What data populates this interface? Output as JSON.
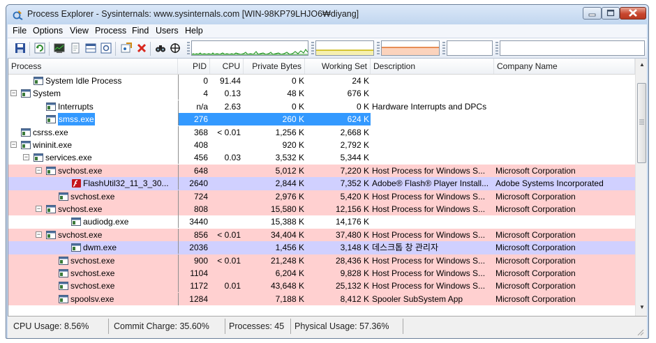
{
  "window": {
    "title": "Process Explorer - Sysinternals: www.sysinternals.com [WIN-98KP79LHJO6₩diyang]"
  },
  "menu": [
    "File",
    "Options",
    "View",
    "Process",
    "Find",
    "Users",
    "Help"
  ],
  "columns": {
    "process": "Process",
    "pid": "PID",
    "cpu": "CPU",
    "private_bytes": "Private Bytes",
    "working_set": "Working Set",
    "description": "Description",
    "company": "Company Name"
  },
  "processes": [
    {
      "name": "System Idle Process",
      "pid": "0",
      "cpu": "91.44",
      "private_bytes": "0 K",
      "working_set": "24 K",
      "description": "",
      "company": "",
      "indent": 1,
      "toggle": "",
      "highlight": "none"
    },
    {
      "name": "System",
      "pid": "4",
      "cpu": "0.13",
      "private_bytes": "48 K",
      "working_set": "676 K",
      "description": "",
      "company": "",
      "indent": 0,
      "toggle": "minus",
      "highlight": "none"
    },
    {
      "name": "Interrupts",
      "pid": "n/a",
      "cpu": "2.63",
      "private_bytes": "0 K",
      "working_set": "0 K",
      "description": "Hardware Interrupts and DPCs",
      "company": "",
      "indent": 2,
      "toggle": "",
      "highlight": "none"
    },
    {
      "name": "smss.exe",
      "pid": "276",
      "cpu": "",
      "private_bytes": "260 K",
      "working_set": "624 K",
      "description": "",
      "company": "",
      "indent": 2,
      "toggle": "",
      "highlight": "selected"
    },
    {
      "name": "csrss.exe",
      "pid": "368",
      "cpu": "< 0.01",
      "private_bytes": "1,256 K",
      "working_set": "2,668 K",
      "description": "",
      "company": "",
      "indent": 0,
      "toggle": "",
      "highlight": "none"
    },
    {
      "name": "wininit.exe",
      "pid": "408",
      "cpu": "",
      "private_bytes": "920 K",
      "working_set": "2,792 K",
      "description": "",
      "company": "",
      "indent": 0,
      "toggle": "minus",
      "highlight": "none"
    },
    {
      "name": "services.exe",
      "pid": "456",
      "cpu": "0.03",
      "private_bytes": "3,532 K",
      "working_set": "5,344 K",
      "description": "",
      "company": "",
      "indent": 1,
      "toggle": "minus",
      "highlight": "none"
    },
    {
      "name": "svchost.exe",
      "pid": "648",
      "cpu": "",
      "private_bytes": "5,012 K",
      "working_set": "7,220 K",
      "description": "Host Process for Windows S...",
      "company": "Microsoft Corporation",
      "indent": 2,
      "toggle": "minus",
      "highlight": "red"
    },
    {
      "name": "FlashUtil32_11_3_30...",
      "pid": "2640",
      "cpu": "",
      "private_bytes": "2,844 K",
      "working_set": "7,352 K",
      "description": "Adobe® Flash® Player Install...",
      "company": "Adobe Systems Incorporated",
      "indent": 4,
      "toggle": "",
      "highlight": "blue",
      "icon": "flash"
    },
    {
      "name": "svchost.exe",
      "pid": "724",
      "cpu": "",
      "private_bytes": "2,976 K",
      "working_set": "5,420 K",
      "description": "Host Process for Windows S...",
      "company": "Microsoft Corporation",
      "indent": 3,
      "toggle": "",
      "highlight": "red"
    },
    {
      "name": "svchost.exe",
      "pid": "808",
      "cpu": "",
      "private_bytes": "15,580 K",
      "working_set": "12,156 K",
      "description": "Host Process for Windows S...",
      "company": "Microsoft Corporation",
      "indent": 2,
      "toggle": "minus",
      "highlight": "red"
    },
    {
      "name": "audiodg.exe",
      "pid": "3440",
      "cpu": "",
      "private_bytes": "15,388 K",
      "working_set": "14,176 K",
      "description": "",
      "company": "",
      "indent": 4,
      "toggle": "",
      "highlight": "none"
    },
    {
      "name": "svchost.exe",
      "pid": "856",
      "cpu": "< 0.01",
      "private_bytes": "34,404 K",
      "working_set": "37,480 K",
      "description": "Host Process for Windows S...",
      "company": "Microsoft Corporation",
      "indent": 2,
      "toggle": "minus",
      "highlight": "red"
    },
    {
      "name": "dwm.exe",
      "pid": "2036",
      "cpu": "",
      "private_bytes": "1,456 K",
      "working_set": "3,148 K",
      "description": "데스크톱 창 관리자",
      "company": "Microsoft Corporation",
      "indent": 4,
      "toggle": "",
      "highlight": "blue"
    },
    {
      "name": "svchost.exe",
      "pid": "900",
      "cpu": "< 0.01",
      "private_bytes": "21,248 K",
      "working_set": "28,436 K",
      "description": "Host Process for Windows S...",
      "company": "Microsoft Corporation",
      "indent": 3,
      "toggle": "",
      "highlight": "red"
    },
    {
      "name": "svchost.exe",
      "pid": "1104",
      "cpu": "",
      "private_bytes": "6,204 K",
      "working_set": "9,828 K",
      "description": "Host Process for Windows S...",
      "company": "Microsoft Corporation",
      "indent": 3,
      "toggle": "",
      "highlight": "red"
    },
    {
      "name": "svchost.exe",
      "pid": "1172",
      "cpu": "0.01",
      "private_bytes": "43,648 K",
      "working_set": "25,132 K",
      "description": "Host Process for Windows S...",
      "company": "Microsoft Corporation",
      "indent": 3,
      "toggle": "",
      "highlight": "red"
    },
    {
      "name": "spoolsv.exe",
      "pid": "1284",
      "cpu": "",
      "private_bytes": "7,188 K",
      "working_set": "8,412 K",
      "description": "Spooler SubSystem App",
      "company": "Microsoft Corporation",
      "indent": 3,
      "toggle": "",
      "highlight": "red"
    }
  ],
  "status": {
    "cpu_usage": "CPU Usage: 8.56%",
    "commit_charge": "Commit Charge: 35.60%",
    "processes": "Processes: 45",
    "physical_usage": "Physical Usage: 57.36%"
  },
  "graphs": {
    "cpu_fraction": 0.0856,
    "commit_fraction": 0.356,
    "physical_fraction": 0.5736
  },
  "colors": {
    "selection": "#3399ff",
    "service_row": "#ffd0d0",
    "own_process_row": "#d0d0ff",
    "cpu_graph": "#2e9b2e",
    "commit_graph": "#c8b400",
    "physical_graph": "#e0702a"
  },
  "icons": [
    "save-icon",
    "refresh-icon",
    "system-info-icon",
    "properties-icon",
    "lower-pane-icon",
    "dll-view-icon",
    "target-icon",
    "kill-process-icon",
    "find-icon",
    "crosshair-icon"
  ]
}
